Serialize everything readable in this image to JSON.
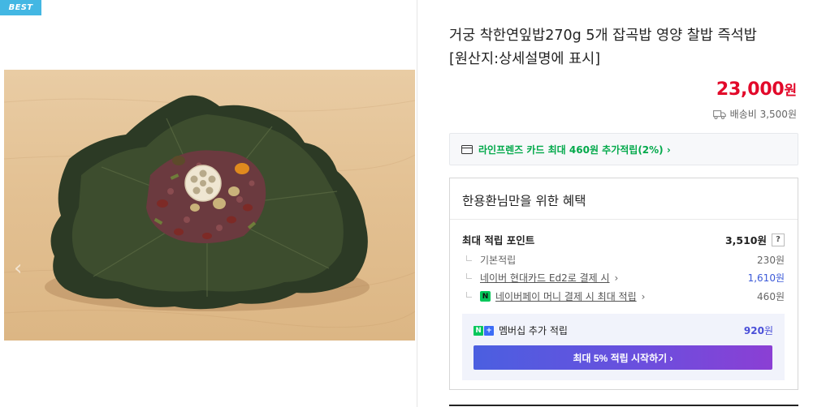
{
  "badge": {
    "label": "BEST"
  },
  "product": {
    "title_line1": "거궁 착한연잎밥270g 5개 잡곡밥 영양 찰밥 즉석밥",
    "title_line2": "[원산지:상세설명에 표시]",
    "price": "23,000",
    "price_unit": "원",
    "shipping": "배송비 3,500원"
  },
  "card_promo": {
    "label": "라인프렌즈 카드 최대 460원 추가적립(2%) ›"
  },
  "benefits": {
    "title": "한용환님만을 위한 혜택",
    "max_points_label": "최대 적립 포인트",
    "max_points_value": "3,510원",
    "help": "?",
    "rows": [
      {
        "label": "기본적립",
        "value": "230원"
      },
      {
        "label": "네이버 현대카드 Ed2로 결제 시",
        "value": "1,610원"
      },
      {
        "label": "네이버페이 머니 결제 시 최대 적립",
        "value": "460원"
      }
    ],
    "member": {
      "label": "멤버십 추가 적립",
      "value": "920",
      "value_unit": "원",
      "badge_n": "N",
      "badge_plus": "+",
      "cta": "최대 5% 적립 시작하기 ›"
    }
  },
  "colors": {
    "price": "#e2092a",
    "accent_green": "#03a94b",
    "accent_blue": "#3c5ad8",
    "badge": "#43b7e3"
  },
  "icons": [
    "truck-icon",
    "card-icon",
    "help-icon",
    "npay-icon",
    "chevron-right-icon"
  ]
}
